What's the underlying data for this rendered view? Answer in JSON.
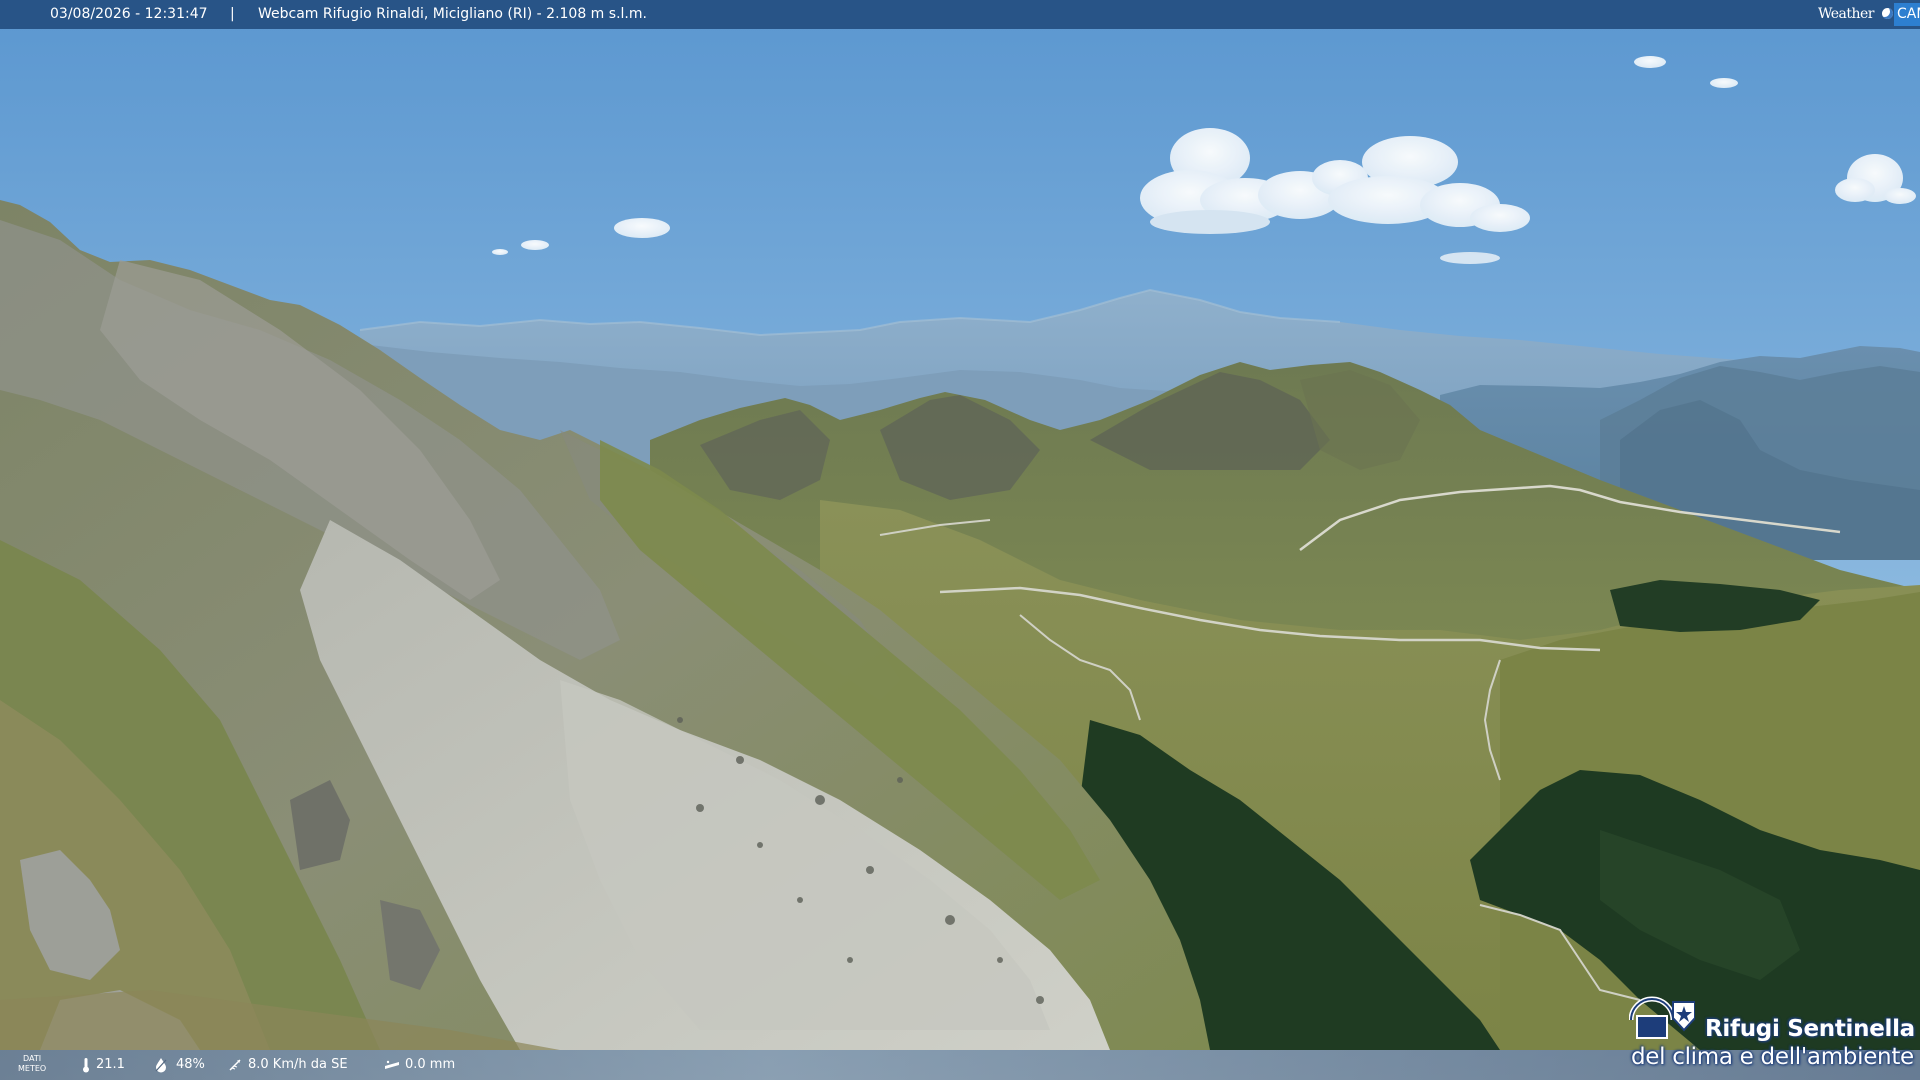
{
  "top_bar": {
    "datetime": "03/08/2026 - 12:31:47",
    "separator": "|",
    "title": "Webcam Rifugio Rinaldi, Micigliano (RI) - 2.108 m s.l.m."
  },
  "brand": {
    "weather_text": "Weather",
    "cam_text": "CAM",
    "accent_color": "#2d7fd0"
  },
  "weather_bar": {
    "label_line1": "DATI",
    "label_line2": "METEO",
    "temperature": "21.1",
    "humidity": "48%",
    "wind": "8.0 Km/h da SE",
    "rain": "0.0 mm",
    "icons": [
      "thermometer-icon",
      "humidity-icon",
      "wind-icon",
      "rain-icon"
    ]
  },
  "logo": {
    "line1": "Rifugi Sentinella",
    "line2": "del clima e dell'ambiente",
    "color": "#1d3d7a"
  },
  "scene": {
    "sky_top": "#5f9bd2",
    "sky_horizon": "#b9d3e6",
    "grass": "#7a8a4a",
    "rock": "#a7aaa2",
    "forest": "#1f3a20"
  }
}
